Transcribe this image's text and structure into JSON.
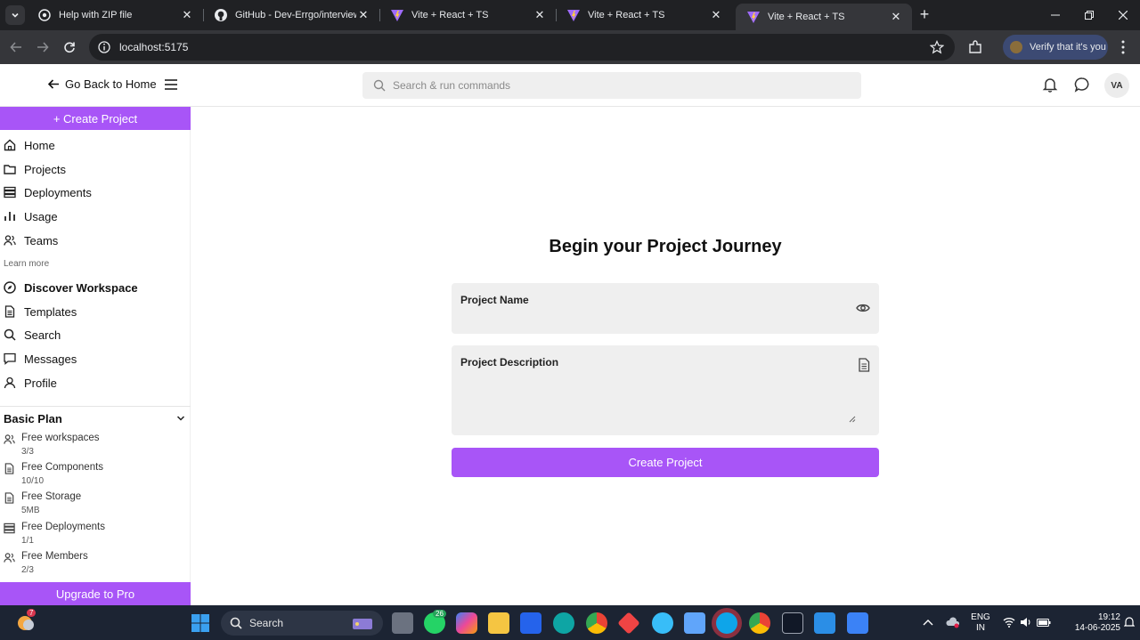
{
  "browser": {
    "tabs": [
      {
        "title": "Help with ZIP file",
        "icon": "chatgpt-icon",
        "active": false
      },
      {
        "title": "GitHub - Dev-Errgo/interview-c",
        "icon": "github-icon",
        "active": false
      },
      {
        "title": "Vite + React + TS",
        "icon": "vite-icon",
        "active": false
      },
      {
        "title": "Vite + React + TS",
        "icon": "vite-icon",
        "active": false
      },
      {
        "title": "Vite + React + TS",
        "icon": "vite-icon",
        "active": true
      }
    ],
    "url": "localhost:5175",
    "profile_label": "Verify that it's you"
  },
  "header": {
    "back_label": "Go Back to Home",
    "search_placeholder": "Search & run commands",
    "avatar_initials": "VA"
  },
  "sidebar": {
    "create_label": "+ Create Project",
    "nav": [
      {
        "label": "Home",
        "icon": "home-icon"
      },
      {
        "label": "Projects",
        "icon": "folder-icon"
      },
      {
        "label": "Deployments",
        "icon": "server-icon"
      },
      {
        "label": "Usage",
        "icon": "bar-chart-icon"
      },
      {
        "label": "Teams",
        "icon": "users-icon"
      }
    ],
    "learn_more": "Learn more",
    "learn": [
      {
        "label": "Discover Workspace",
        "icon": "compass-icon"
      },
      {
        "label": "Templates",
        "icon": "document-icon"
      },
      {
        "label": "Search",
        "icon": "search-icon"
      },
      {
        "label": "Messages",
        "icon": "message-icon"
      },
      {
        "label": "Profile",
        "icon": "user-icon"
      }
    ],
    "plan": {
      "title": "Basic Plan",
      "items": [
        {
          "label": "Free workspaces",
          "value": "3/3",
          "icon": "users-icon"
        },
        {
          "label": "Free Components",
          "value": "10/10",
          "icon": "document-icon"
        },
        {
          "label": "Free Storage",
          "value": "5MB",
          "icon": "document-icon"
        },
        {
          "label": "Free Deployments",
          "value": "1/1",
          "icon": "server-icon"
        },
        {
          "label": "Free Members",
          "value": "2/3",
          "icon": "users-icon"
        }
      ]
    },
    "upgrade_label": "Upgrade to Pro"
  },
  "main": {
    "heading": "Begin your Project Journey",
    "name_label": "Project Name",
    "name_value": "",
    "description_label": "Project Description",
    "description_value": "",
    "submit_label": "Create Project"
  },
  "taskbar": {
    "search_label": "Search",
    "whatsapp_badge": "26",
    "weather_badge": "7",
    "lang_top": "ENG",
    "lang_bottom": "IN",
    "time": "19:12",
    "date": "14-06-2025"
  },
  "colors": {
    "accent": "#a855f7",
    "chrome_dark": "#202124",
    "chrome_mid": "#35363a",
    "field_bg": "#efefef"
  }
}
